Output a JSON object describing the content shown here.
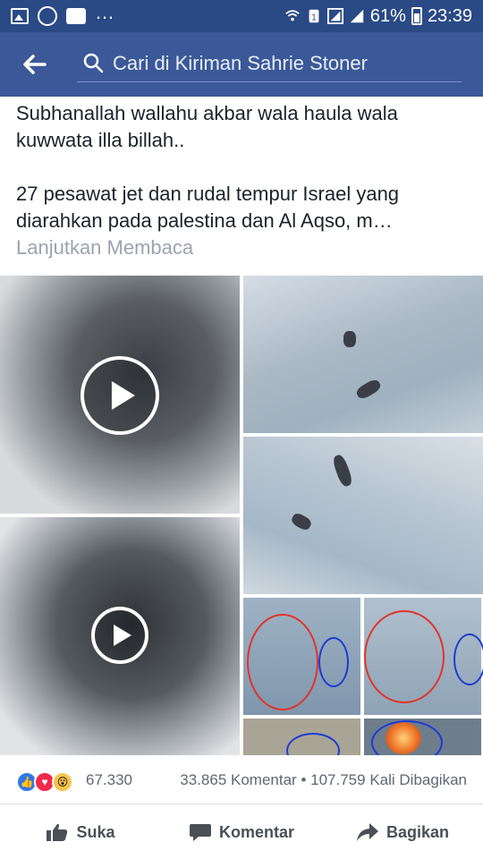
{
  "status_bar": {
    "battery_percent": "61%",
    "time": "23:39",
    "left_icons": [
      "gallery-icon",
      "messenger-icon",
      "chat-icon",
      "more-dots-icon"
    ],
    "right_icons": [
      "wifi-icon",
      "sim-icon",
      "signal-icon",
      "signal-icon",
      "battery-icon"
    ]
  },
  "header": {
    "search_placeholder": "Cari di Kiriman Sahrie Stoner",
    "background_color": "#3b5998",
    "status_bar_color": "#2a4a86"
  },
  "post": {
    "line1": "Subhanallah wallahu akbar wala haula wala",
    "line2": "kuwwata illa billah..",
    "line3": "27 pesawat jet dan rudal tempur Israel yang",
    "line4": "diarahkan pada palestina dan Al Aqso,  m…",
    "read_more": "Lanjutkan Membaca"
  },
  "media": {
    "items": [
      "video",
      "image",
      "image",
      "video",
      "image"
    ]
  },
  "stats": {
    "reaction_icons": [
      "like-reaction-icon",
      "love-reaction-icon",
      "wow-reaction-icon"
    ],
    "reaction_count": "67.330",
    "comments": "33.865 Komentar",
    "separator": "•",
    "shares": "107.759 Kali Dibagikan"
  },
  "actions": {
    "like": "Suka",
    "comment": "Komentar",
    "share": "Bagikan"
  }
}
